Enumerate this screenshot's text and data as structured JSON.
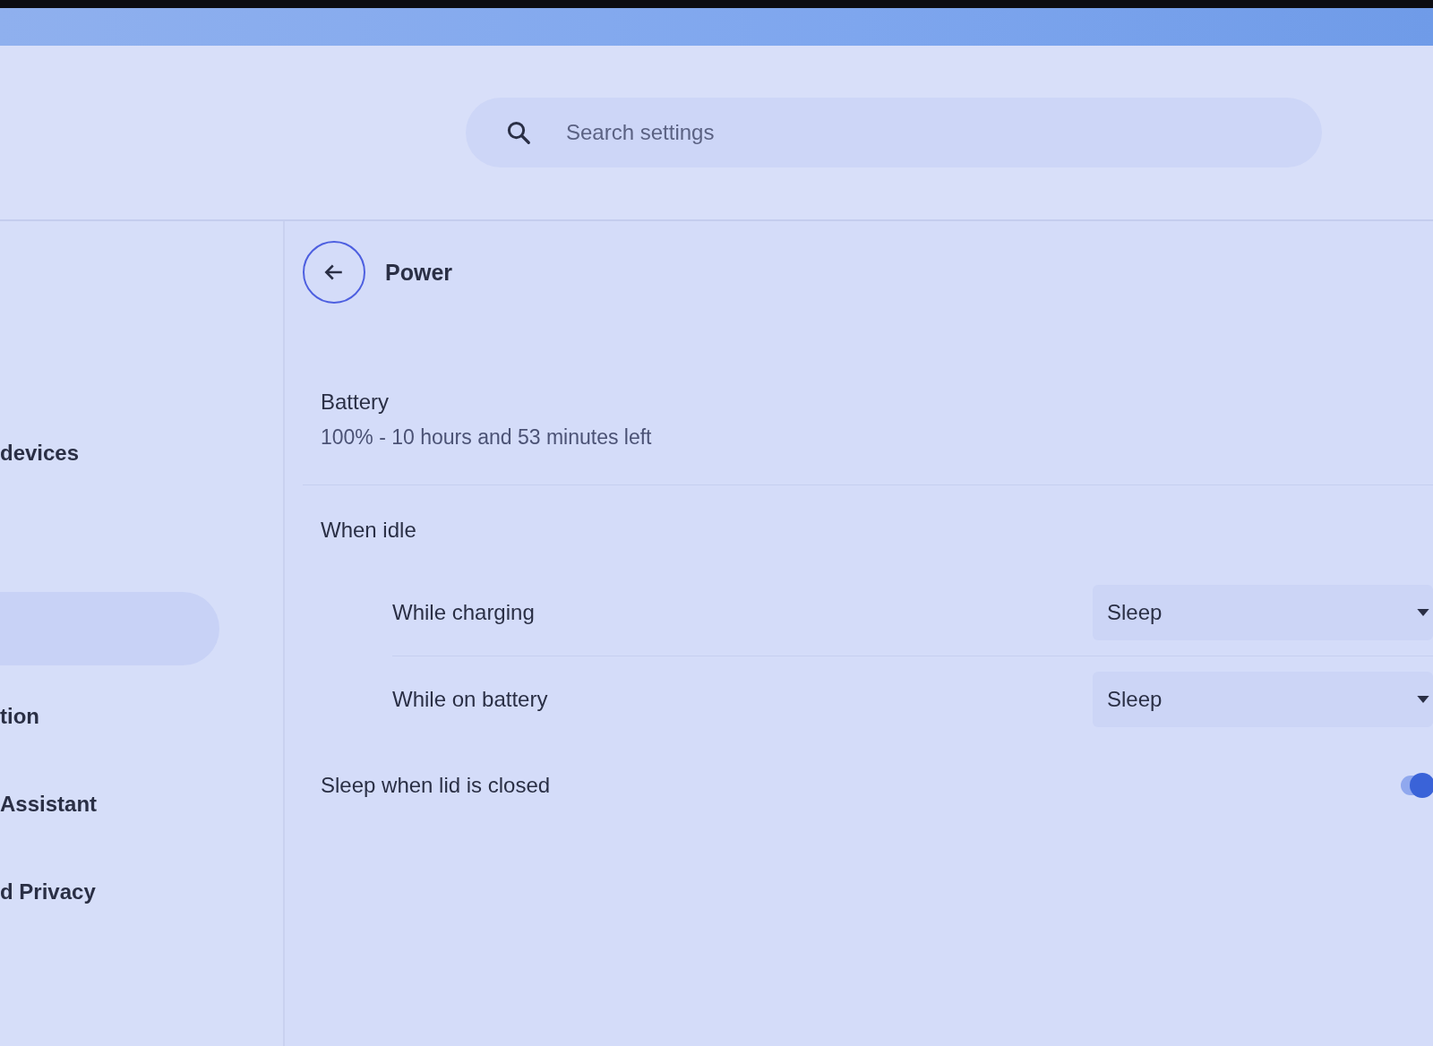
{
  "search": {
    "placeholder": "Search settings"
  },
  "sidebar": {
    "items": [
      {
        "label": "devices",
        "selected": false
      },
      {
        "selected": true
      },
      {
        "label": "tion",
        "selected": false
      },
      {
        "label": "Assistant",
        "selected": false
      },
      {
        "label": "d Privacy",
        "selected": false
      }
    ]
  },
  "page": {
    "title": "Power"
  },
  "battery": {
    "label": "Battery",
    "status": "100% - 10 hours and 53 minutes left"
  },
  "idle": {
    "label": "When idle",
    "rows": [
      {
        "label": "While charging",
        "value": "Sleep"
      },
      {
        "label": "While on battery",
        "value": "Sleep"
      }
    ]
  },
  "lid": {
    "label": "Sleep when lid is closed",
    "on": true
  }
}
